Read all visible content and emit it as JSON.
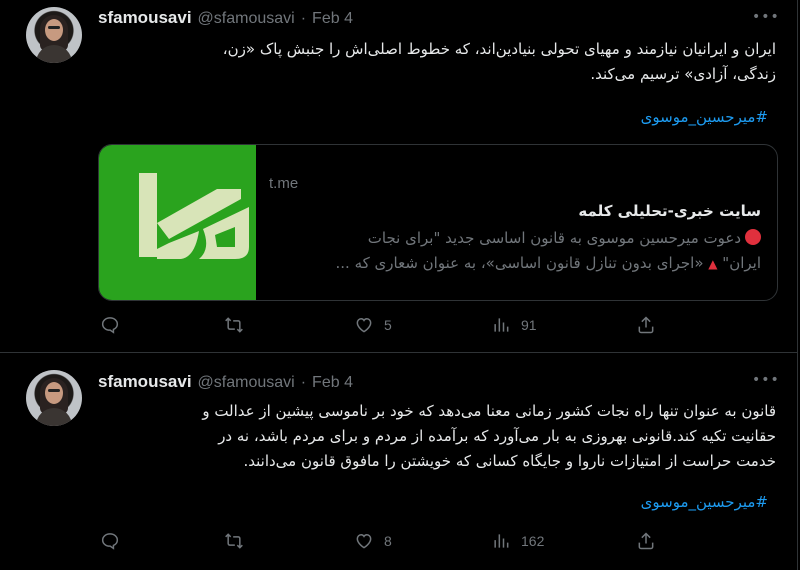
{
  "tweets": [
    {
      "name": "sfamousavi",
      "handle": "@sfamousavi",
      "separator": "·",
      "date": "Feb 4",
      "text_line1": "ایران و ایرانیان نیازمند و مهیای تحولی بنیادین‌اند، که خطوط اصلی‌اش را جنبش پاک «زن،",
      "text_line2": "زندگی، آزادی» ترسیم می‌کند.",
      "hashtag": "#میرحسین_موسوی",
      "card": {
        "domain": "t.me",
        "title": "سایت خبری-تحلیلی کلمه",
        "desc_line1": "دعوت میرحسین موسوی به قانون اساسی جدید \"برای نجات",
        "desc_line2a": "ایران\"",
        "desc_line2b": "«اجرای بدون تنازل قانون اساسی»، به عنوان شعاری که ..."
      },
      "likes": "5",
      "views": "91"
    },
    {
      "name": "sfamousavi",
      "handle": "@sfamousavi",
      "separator": "·",
      "date": "Feb 4",
      "text_line1": "قانون به عنوان تنها راه نجات کشور زمانی معنا می‌دهد که خود بر ناموسی پیشین از عدالت و",
      "text_line2": "حقانیت تکیه کند.قانونی بهروزی به بار می‌آورد که برآمده از مردم و برای مردم باشد، نه در",
      "text_line3": "خدمت حراست از امتیازات ناروا و جایگاه کسانی که خویشتن را مافوق قانون می‌دانند.",
      "hashtag": "#میرحسین_موسوی",
      "likes": "8",
      "views": "162"
    }
  ],
  "icons": {
    "reply": "reply-icon",
    "retweet": "retweet-icon",
    "like": "heart-icon",
    "views": "views-icon",
    "share": "share-icon",
    "more": "more-icon"
  },
  "colors": {
    "background": "#000000",
    "text": "#e7e9ea",
    "muted": "#71767b",
    "link": "#1d9bf0",
    "card_thumb": "#2aa31e",
    "red_marker": "#e0303d"
  }
}
